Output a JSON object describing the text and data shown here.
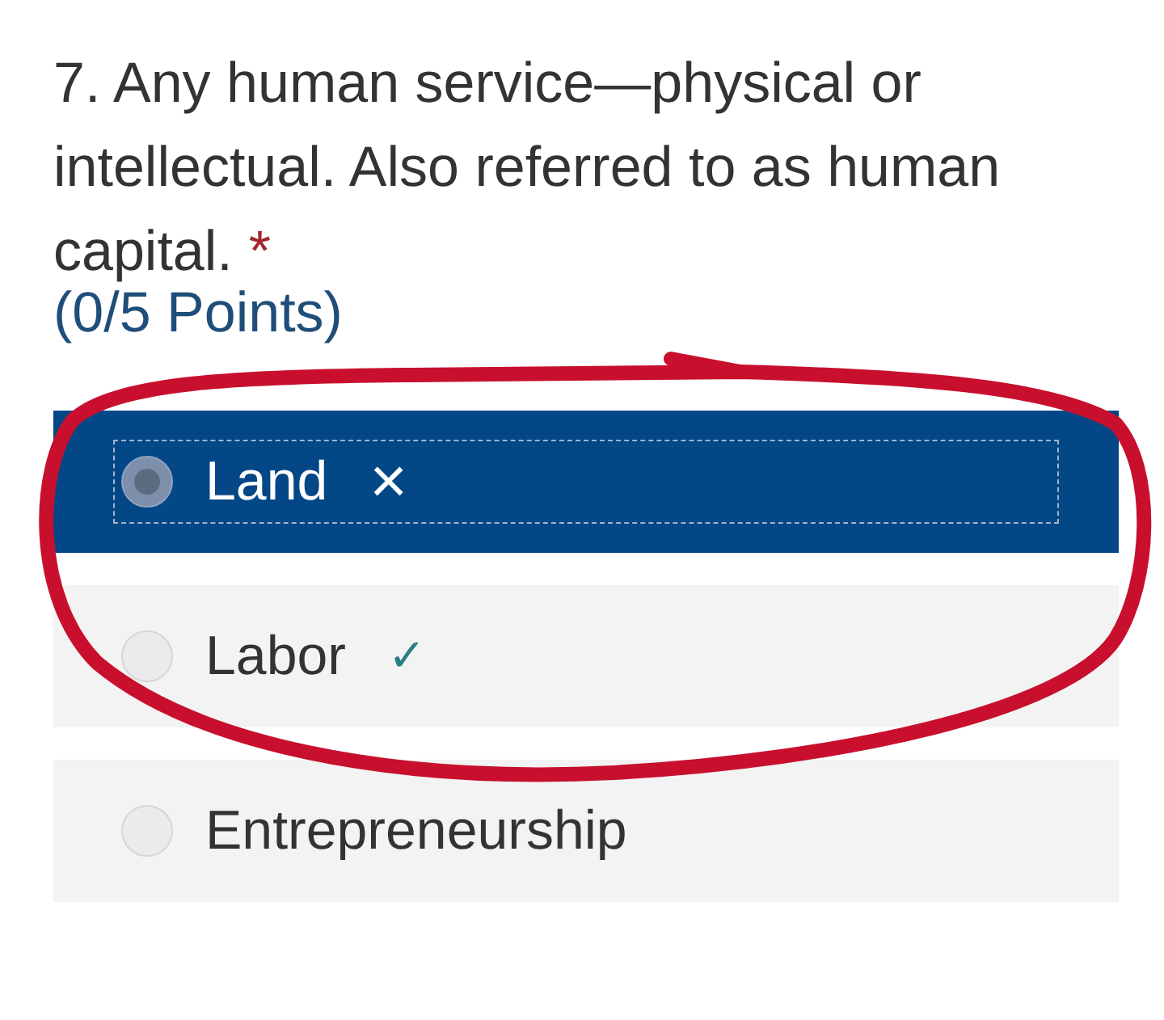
{
  "question": {
    "number": "7.",
    "text": "Any human service—physical or intellectual. Also referred to as human capital.",
    "required_mark": "*",
    "points": "(0/5 Points)"
  },
  "options": [
    {
      "label": "Land",
      "selected": true,
      "kind": "incorrect",
      "result_icon": "×"
    },
    {
      "label": "Labor",
      "selected": false,
      "kind": "correct",
      "result_icon": "✓"
    },
    {
      "label": "Entrepreneurship",
      "selected": false,
      "kind": "plain"
    }
  ],
  "annotation": {
    "kind": "circle"
  }
}
